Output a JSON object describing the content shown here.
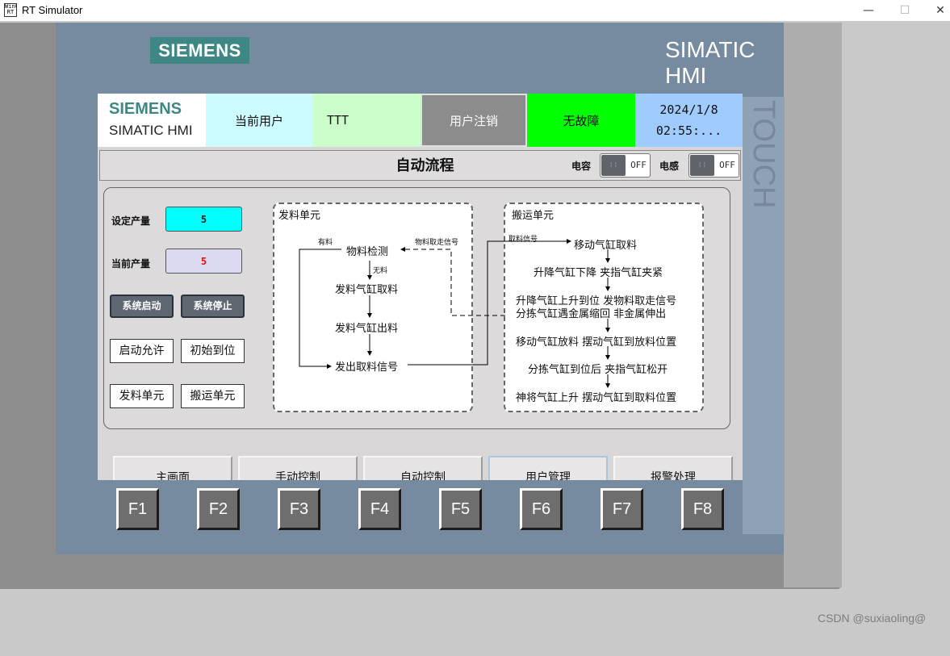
{
  "window": {
    "title": "RT Simulator",
    "icon_text": "WinCC RT",
    "controls": {
      "minimize": "—",
      "maximize": "☐",
      "close": "✕"
    }
  },
  "device": {
    "brand": "SIEMENS",
    "model": "SIMATIC HMI",
    "side_label": "TOUCH",
    "fkeys": [
      "F1",
      "F2",
      "F3",
      "F4",
      "F5",
      "F6",
      "F7",
      "F8"
    ]
  },
  "header": {
    "logo_top": "SIEMENS",
    "logo_bottom": "SIMATIC HMI",
    "user_label": "当前用户",
    "user_value": "TTT",
    "logout_label": "用户注销",
    "status_text": "无故障",
    "date": "2024/1/8",
    "time": "02:55:..."
  },
  "titlebar": {
    "title": "自动流程",
    "capacitive_label": "电容",
    "capacitive_state": "OFF",
    "inductive_label": "电感",
    "inductive_state": "OFF"
  },
  "controls": {
    "setpoint_label": "设定产量",
    "setpoint_value": "5",
    "current_label": "当前产量",
    "current_value": "5",
    "start_button": "系统启动",
    "stop_button": "系统停止",
    "start_allowed": "启动允许",
    "initial_position": "初始到位",
    "feed_unit": "发料单元",
    "transport_unit": "搬运单元"
  },
  "feed_flow": {
    "title": "发料单元",
    "has_material": "有料",
    "detect": "物料检测",
    "no_material": "无料",
    "pick_cylinder": "发料气缸取料",
    "out_cylinder": "发料气缸出料",
    "send_signal": "发出取料信号",
    "taken_signal": "物料取走信号"
  },
  "transport_flow": {
    "title": "搬运单元",
    "pick_signal": "取料信号",
    "steps": [
      "移动气缸取料",
      "升降气缸下降  夹指气缸夹紧",
      "升降气缸上升到位  发物料取走信号",
      "分拣气缸遇金属缩回  非金属伸出",
      "移动气缸放料  摆动气缸到放料位置",
      "分拣气缸到位后  夹指气缸松开",
      "神将气缸上升  摆动气缸到取料位置"
    ]
  },
  "nav": {
    "items": [
      "主画面",
      "手动控制",
      "自动控制",
      "用户管理",
      "报警处理"
    ],
    "active_index": 3
  },
  "watermark": "CSDN @suxiaoling@"
}
